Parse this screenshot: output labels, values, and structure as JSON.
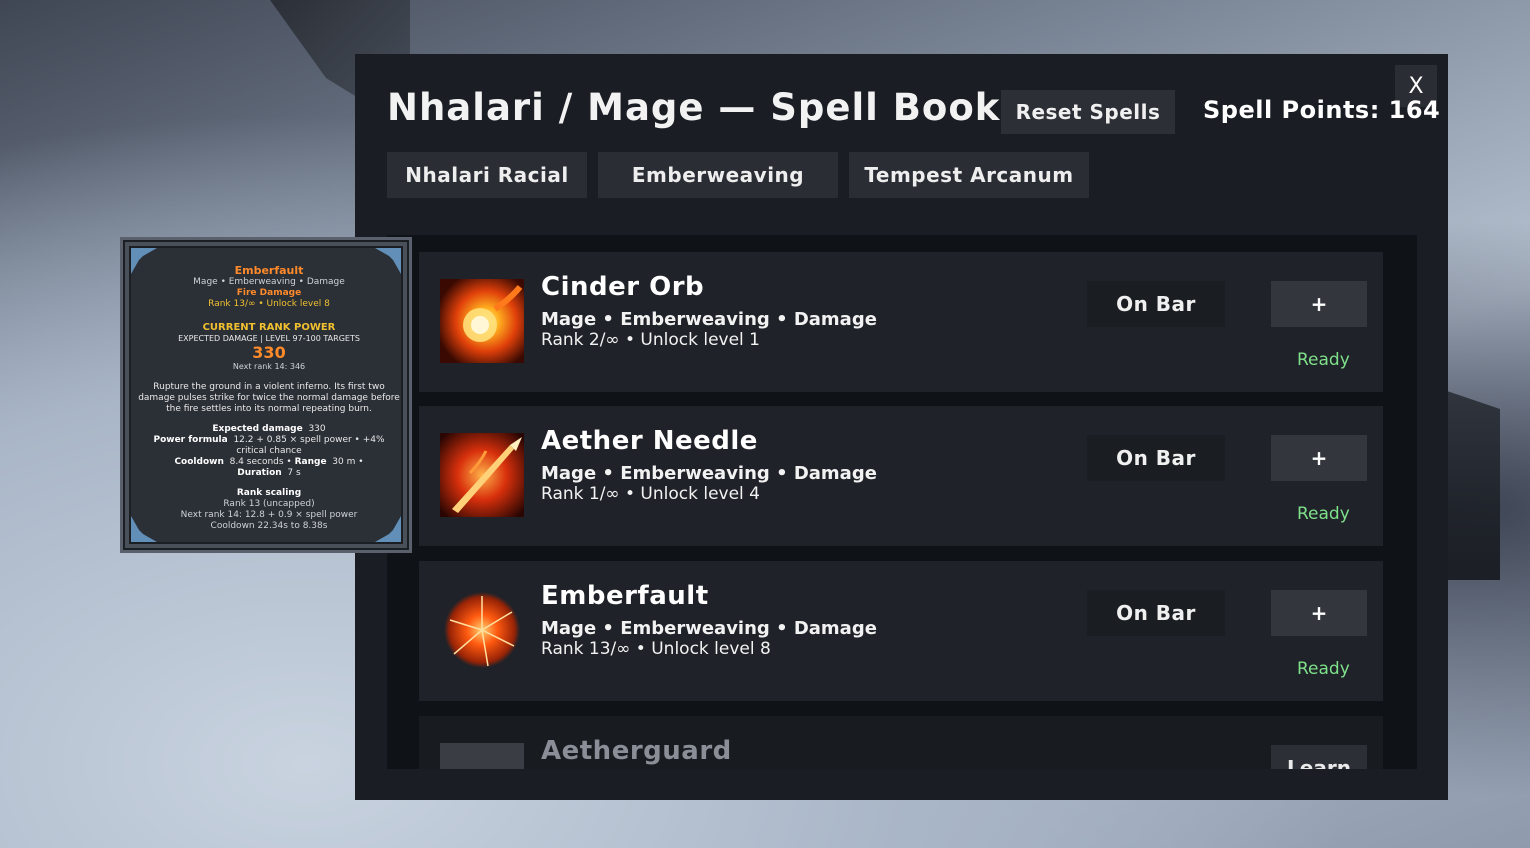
{
  "panel": {
    "title": "Nhalari / Mage — Spell Book",
    "reset_label": "Reset Spells",
    "points_text": "Spell Points: 164",
    "close_label": "X"
  },
  "tabs": [
    {
      "label": "Nhalari Racial"
    },
    {
      "label": "Emberweaving"
    },
    {
      "label": "Tempest Arcanum"
    }
  ],
  "spells": [
    {
      "name": "Cinder Orb",
      "tags": "Mage • Emberweaving • Damage",
      "rank": "Rank 2/∞ • Unlock level 1",
      "bar_label": "On Bar",
      "action_label": "+",
      "status": "Ready",
      "icon": "cinder-orb-icon"
    },
    {
      "name": "Aether Needle",
      "tags": "Mage • Emberweaving • Damage",
      "rank": "Rank 1/∞ • Unlock level 4",
      "bar_label": "On Bar",
      "action_label": "+",
      "status": "Ready",
      "icon": "aether-needle-icon"
    },
    {
      "name": "Emberfault",
      "tags": "Mage • Emberweaving • Damage",
      "rank": "Rank 13/∞ • Unlock level 8",
      "bar_label": "On Bar",
      "action_label": "+",
      "status": "Ready",
      "icon": "emberfault-icon"
    },
    {
      "name": "Aetherguard",
      "action_label": "Learn",
      "icon": "aetherguard-icon"
    }
  ],
  "tooltip": {
    "name": "Emberfault",
    "tags": "Mage • Emberweaving • Damage",
    "school": "Fire Damage",
    "rank_line": "Rank 13/∞ • Unlock level 8",
    "power_heading": "CURRENT RANK POWER",
    "expected_heading": "EXPECTED DAMAGE | LEVEL 97-100 TARGETS",
    "damage_value": "330",
    "next_rank": "Next rank 14: 346",
    "description": "Rupture the ground in a violent inferno. Its first two damage pulses strike for twice the normal damage before the fire settles into its normal repeating burn.",
    "expected_label": "Expected damage",
    "expected_value": "330",
    "formula_label": "Power formula",
    "formula_value": "12.2 + 0.85 × spell power • +4% critical chance",
    "cooldown_label": "Cooldown",
    "cooldown_value": "8.4 seconds",
    "range_label": "Range",
    "range_value": "30 m •",
    "duration_label": "Duration",
    "duration_value": "7 s",
    "scaling_heading": "Rank scaling",
    "scaling_rank": "Rank 13 (uncapped)",
    "scaling_next": "Next rank 14:  12.8 + 0.9 × spell power",
    "scaling_cooldown": "Cooldown 22.34s to 8.38s"
  },
  "colors": {
    "ready": "#7fe08a",
    "tooltip_name": "#ff8a2a",
    "tooltip_heading": "#f0c030"
  }
}
